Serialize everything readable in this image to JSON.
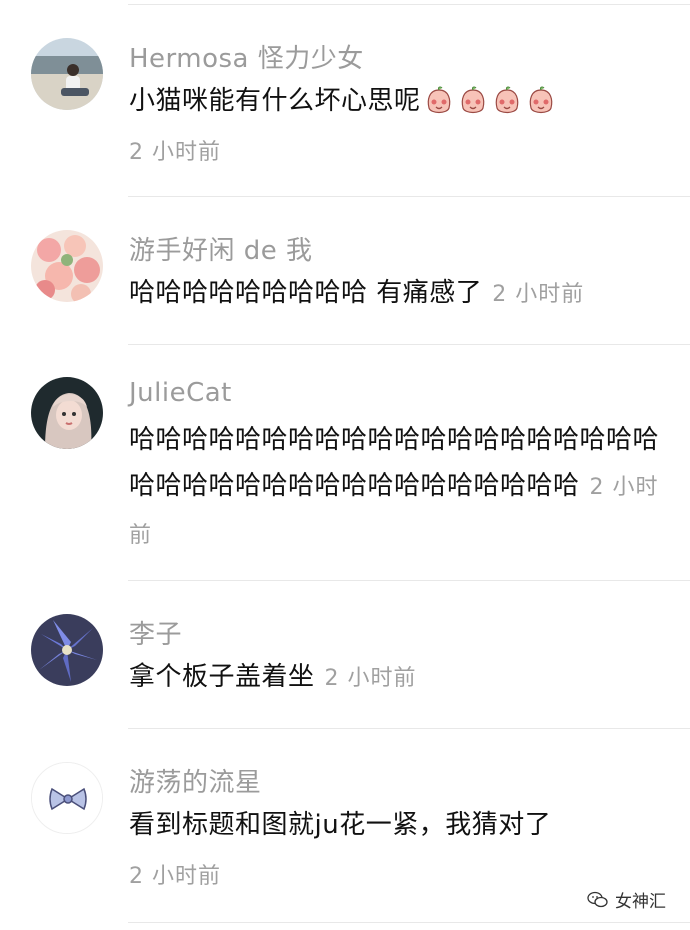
{
  "comments": [
    {
      "name": "Hermosa 怪力少女",
      "text": "小猫咪能有什么坏心思呢",
      "emojis": [
        "peach-face-icon",
        "peach-face-icon",
        "peach-face-icon",
        "peach-face-icon"
      ],
      "time": "2 小时前",
      "avatar": "beach-photo-avatar"
    },
    {
      "name": "游手好闲 de 我",
      "text": "哈哈哈哈哈哈哈哈哈 有痛感了",
      "time": "2 小时前",
      "avatar": "flowers-avatar"
    },
    {
      "name": "JulieCat",
      "text": "哈哈哈哈哈哈哈哈哈哈哈哈哈哈哈哈哈哈哈哈哈哈哈哈哈哈哈哈哈哈哈哈哈哈哈哈哈",
      "time": "2 小时前",
      "avatar": "girl-portrait-avatar"
    },
    {
      "name": "李子",
      "text": "拿个板子盖着坐",
      "time": "2 小时前",
      "avatar": "blue-flower-avatar"
    },
    {
      "name": "游荡的流星",
      "text": "看到标题和图就ju花一紧，我猜对了",
      "time": "2 小时前",
      "avatar": "bow-avatar"
    }
  ],
  "watermark": {
    "label": "女神汇"
  },
  "colors": {
    "name": "#9b9b9b",
    "text": "#111111",
    "time": "#a0a0a0",
    "divider": "#e8e8e8"
  }
}
